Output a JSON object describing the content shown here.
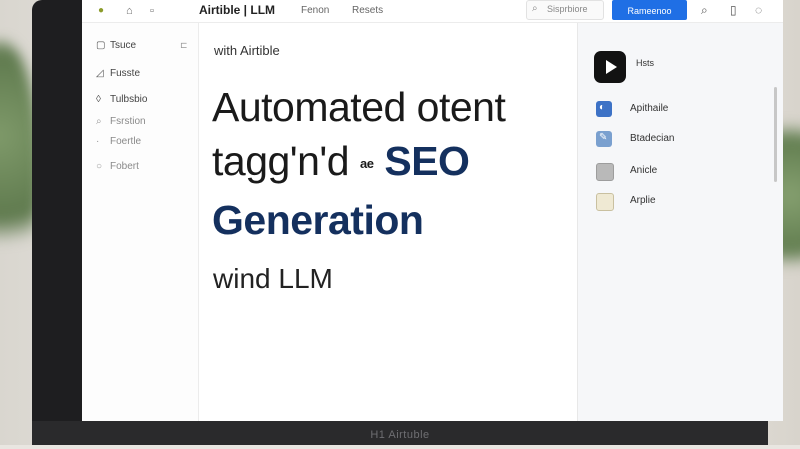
{
  "topbar": {
    "brand": "Airtible | LLM",
    "nav": [
      "Fenon",
      "Resets"
    ],
    "search_text": "Sisprbiore",
    "primary_button": "Rameenoo"
  },
  "sidebar": {
    "items": [
      {
        "label": "Tsuce",
        "icon": "square-icon"
      },
      {
        "label": "Fusste",
        "icon": "image-icon"
      },
      {
        "label": "Tulbsbio",
        "icon": "drop-icon"
      },
      {
        "label": "Fsrstion",
        "icon": "search-icon"
      },
      {
        "label": "Foertle",
        "icon": "dot-icon"
      },
      {
        "label": "Fobert",
        "icon": "circle-icon"
      }
    ]
  },
  "main": {
    "kicker": "with Airtible",
    "headline_1": "Automated otent",
    "headline_2_a": "tagg'n'd",
    "headline_2_small": "ae",
    "headline_2_b": "SEO",
    "headline_3": "Generation",
    "subline": "wind  LLM"
  },
  "right_panel": {
    "play_label": "Hsts",
    "items": [
      {
        "label": "Apithaile"
      },
      {
        "label": "Btadecian"
      },
      {
        "label": "Anicle"
      },
      {
        "label": "Arplie"
      }
    ]
  },
  "device": {
    "chin_label": "H1 Airtuble"
  },
  "colors": {
    "accent": "#1f6fe5",
    "headline_navy": "#14305e"
  }
}
